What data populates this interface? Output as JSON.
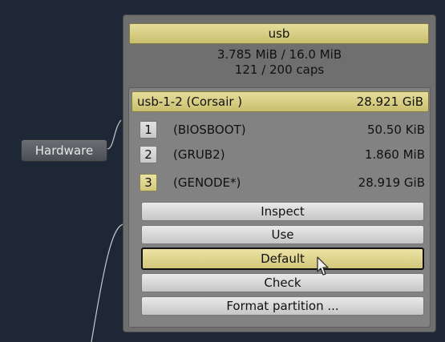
{
  "hardware_node": {
    "label": "Hardware"
  },
  "panel": {
    "title": "usb",
    "ram": "3.785 MiB / 16.0 MiB",
    "caps": "121 / 200 caps"
  },
  "device": {
    "name": "usb-1-2 (Corsair )",
    "size": "28.921 GiB"
  },
  "partitions": [
    {
      "number": "1",
      "name": "(BIOSBOOT)",
      "size": "50.50 KiB",
      "selected": false
    },
    {
      "number": "2",
      "name": "(GRUB2)",
      "size": "1.860 MiB",
      "selected": false
    },
    {
      "number": "3",
      "name": "(GENODE*)",
      "size": "28.919 GiB",
      "selected": true
    }
  ],
  "actions": {
    "inspect": "Inspect",
    "use": "Use",
    "default": "Default",
    "check": "Check",
    "format": "Format partition ..."
  },
  "colors": {
    "background": "#1d2736",
    "highlight": "#d8cf86",
    "panel": "#6f6f6f",
    "connector": "#c8c8c8"
  }
}
